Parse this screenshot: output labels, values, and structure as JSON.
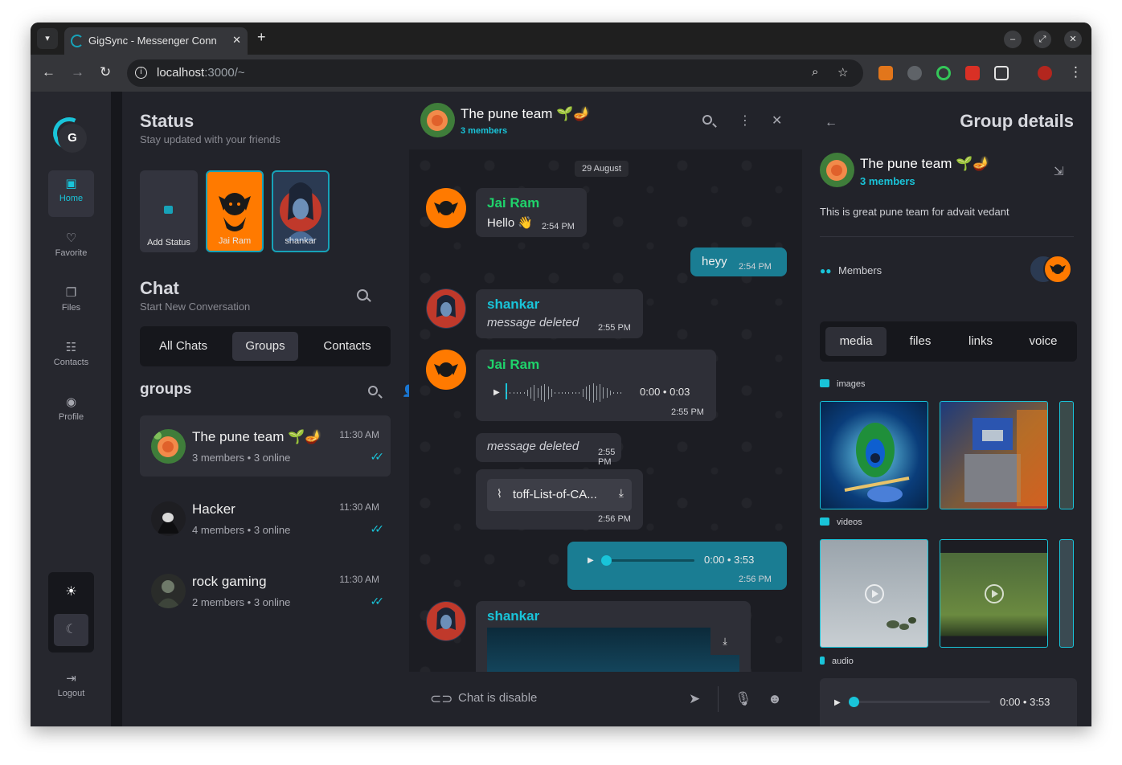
{
  "browser": {
    "tab_title": "GigSync - Messenger Conn",
    "url_host": "localhost",
    "url_rest": ":3000/~",
    "tab_close": "✕",
    "new_tab": "+"
  },
  "rail": {
    "logo_letter": "G",
    "items": [
      {
        "label": "Home",
        "icon": "grid-icon"
      },
      {
        "label": "Favorite",
        "icon": "heart-icon"
      },
      {
        "label": "Files",
        "icon": "files-icon"
      },
      {
        "label": "Contacts",
        "icon": "contacts-icon"
      },
      {
        "label": "Profile",
        "icon": "profile-icon"
      }
    ],
    "logout": "Logout"
  },
  "status": {
    "title": "Status",
    "subtitle": "Stay updated with your friends",
    "stories": [
      {
        "label": "Add Status"
      },
      {
        "label": "Jai Ram"
      },
      {
        "label": "shankar"
      }
    ]
  },
  "chat_section": {
    "title": "Chat",
    "subtitle": "Start New Conversation",
    "tabs": [
      "All Chats",
      "Groups",
      "Contacts"
    ],
    "active_tab": "Groups",
    "list_heading": "groups"
  },
  "groups": [
    {
      "name": "The pune team 🌱🪔",
      "members": "3 members",
      "online": "3 online",
      "time": "11:30 AM"
    },
    {
      "name": "Hacker",
      "members": "4 members",
      "online": "3 online",
      "time": "11:30 AM"
    },
    {
      "name": "rock gaming",
      "members": "2 members",
      "online": "3 online",
      "time": "11:30 AM"
    }
  ],
  "conversation": {
    "title": "The pune team 🌱🪔",
    "subtitle": "3 members",
    "date": "29 August",
    "messages": [
      {
        "sender": "Jai Ram",
        "text": "Hello 👋",
        "time": "2:54 PM"
      },
      {
        "sender": "",
        "text": "heyy",
        "time": "2:54 PM"
      },
      {
        "sender": "shankar",
        "text": "message deleted",
        "time": "2:55 PM"
      },
      {
        "sender": "Jai Ram",
        "text": "",
        "audio_current": "0:00",
        "audio_total": "0:03",
        "time": "2:55 PM"
      },
      {
        "sender": "",
        "text": "message deleted",
        "time": "2:55 PM"
      },
      {
        "sender": "",
        "file": "toff-List-of-CA...",
        "time": "2:56 PM"
      },
      {
        "sender": "",
        "audio_current": "0:00",
        "audio_total": "3:53",
        "time": "2:56 PM"
      },
      {
        "sender": "shankar",
        "text": ""
      }
    ],
    "input_placeholder": "Chat is disable"
  },
  "details": {
    "title": "Group details",
    "group_name": "The pune team 🌱🪔",
    "members_count": "3 members",
    "description": "This is great pune team for advait vedant",
    "members_label": "Members",
    "tabs": [
      "media",
      "files",
      "links",
      "voice"
    ],
    "active_tab": "media",
    "sections": {
      "images": "images",
      "videos": "videos",
      "audio": "audio"
    },
    "audio_current": "0:00",
    "audio_total": "3:53"
  },
  "colors": {
    "accent": "#19c4d9",
    "green_name": "#1fd36b",
    "bubble_mine": "#1a7d93",
    "avatar_orange": "#ff7a00"
  }
}
